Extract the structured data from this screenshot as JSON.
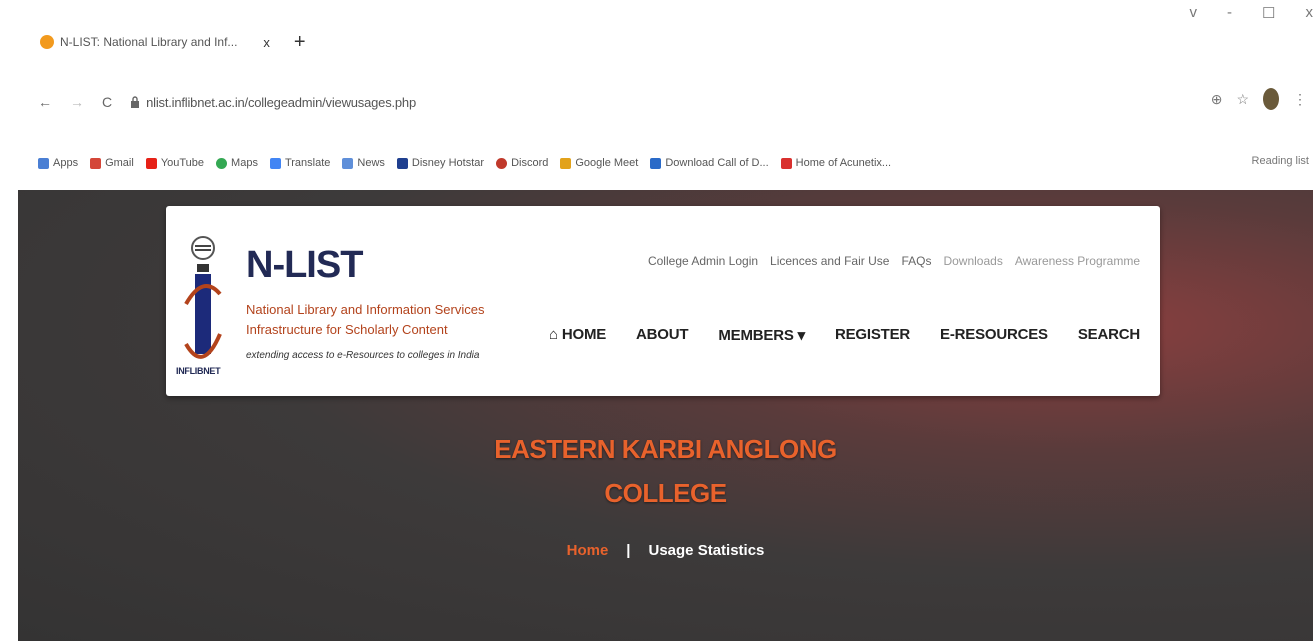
{
  "browser": {
    "tab_title": "N-LIST: National Library and Inf...",
    "tab_close": "x",
    "new_tab": "+",
    "window_controls": [
      "v",
      "-",
      "☐",
      "x"
    ],
    "nav": {
      "back": "←",
      "forward": "→",
      "reload": "C"
    },
    "url": "nlist.inflibnet.ac.in/collegeadmin/viewusages.php",
    "bookmarks": [
      "Apps",
      "Gmail",
      "YouTube",
      "Maps",
      "Translate",
      "News",
      "Disney Hotstar",
      "Discord",
      "Google Meet",
      "Download Call of D...",
      "Home of Acunetix..."
    ],
    "reading_list": "Reading list",
    "colors": {
      "favicon": "#f29a1e"
    }
  },
  "site": {
    "logo_title": "N-LIST",
    "logo_sub1": "National Library and Information Services",
    "logo_sub2": "Infrastructure for Scholarly Content",
    "logo_tag": "extending access to e-Resources to colleges in India",
    "logo_org": "INFLIBNET",
    "top_links": [
      "College Admin Login",
      "Licences and Fair Use",
      "FAQs",
      "Downloads",
      "Awareness Programme"
    ],
    "nav": {
      "home": "HOME",
      "about": "ABOUT",
      "members": "MEMBERS ▾",
      "register": "REGISTER",
      "eresources": "E-RESOURCES",
      "search": "SEARCH"
    },
    "college_line1": "EASTERN KARBI ANGLONG",
    "college_line2": "COLLEGE",
    "breadcrumb": {
      "home": "Home",
      "separator": "|",
      "current": "Usage Statistics"
    },
    "colors": {
      "accent": "#e8622c",
      "navy": "#222a55"
    }
  }
}
